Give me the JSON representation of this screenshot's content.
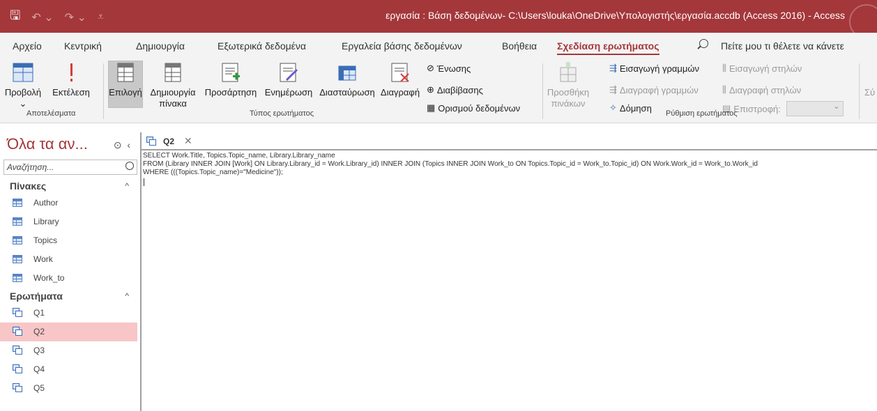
{
  "titlebar": {
    "title": "εργασία : Βάση δεδομένων- C:\\Users\\louka\\OneDrive\\Υπολογιστής\\εργασία.accdb (Access 2016)  -  Access"
  },
  "tabs": [
    "Αρχείο",
    "Κεντρική",
    "Δημιουργία",
    "Εξωτερικά δεδομένα",
    "Εργαλεία βάσης δεδομένων",
    "Βοήθεια",
    "Σχεδίαση ερωτήματος"
  ],
  "tell_me": "Πείτε μου τι θέλετε να κάνετε",
  "ribbon": {
    "view_label": "Προβολή",
    "run_label": "Εκτέλεση",
    "results_group": "Αποτελέσματα",
    "select_label": "Επιλογή",
    "make_table_label_1": "Δημιουργία",
    "make_table_label_2": "πίνακα",
    "append_label": "Προσάρτηση",
    "update_label": "Ενημέρωση",
    "crosstab_label": "Διασταύρωση",
    "delete_label": "Διαγραφή",
    "union_label": "Ένωσης",
    "passthrough_label": "Διαβίβασης",
    "datadef_label": "Ορισμού δεδομένων",
    "query_type_group": "Τύπος ερωτήματος",
    "show_table_label_1": "Προσθήκη",
    "show_table_label_2": "πινάκων",
    "insert_rows_label": "Εισαγωγή γραμμών",
    "delete_rows_label": "Διαγραφή γραμμών",
    "builder_label": "Δόμηση",
    "insert_cols_label": "Εισαγωγή στηλών",
    "delete_cols_label": "Διαγραφή στηλών",
    "return_label": "Επιστροφή:",
    "setup_group": "Ρύθμιση ερωτήματος",
    "cut_label": "Σύ"
  },
  "nav": {
    "header": "Όλα τα αν...",
    "search_placeholder": "Αναζήτηση...",
    "tables_title": "Πίνακες",
    "tables": [
      "Author",
      "Library",
      "Topics",
      "Work",
      "Work_to"
    ],
    "queries_title": "Ερωτήματα",
    "queries": [
      "Q1",
      "Q2",
      "Q3",
      "Q4",
      "Q5"
    ],
    "selected_query": "Q2"
  },
  "document": {
    "tab_label": "Q2",
    "sql": "SELECT Work.Title, Topics.Topic_name, Library.Library_name\nFROM (Library INNER JOIN [Work] ON Library.Library_id = Work.Library_id) INNER JOIN (Topics INNER JOIN Work_to ON Topics.Topic_id = Work_to.Topic_id) ON Work.Work_id = Work_to.Work_id\nWHERE (((Topics.Topic_name)=\"Medicine\"));"
  },
  "colors": {
    "accent": "#a4373a",
    "selection": "#f8c6c7"
  }
}
